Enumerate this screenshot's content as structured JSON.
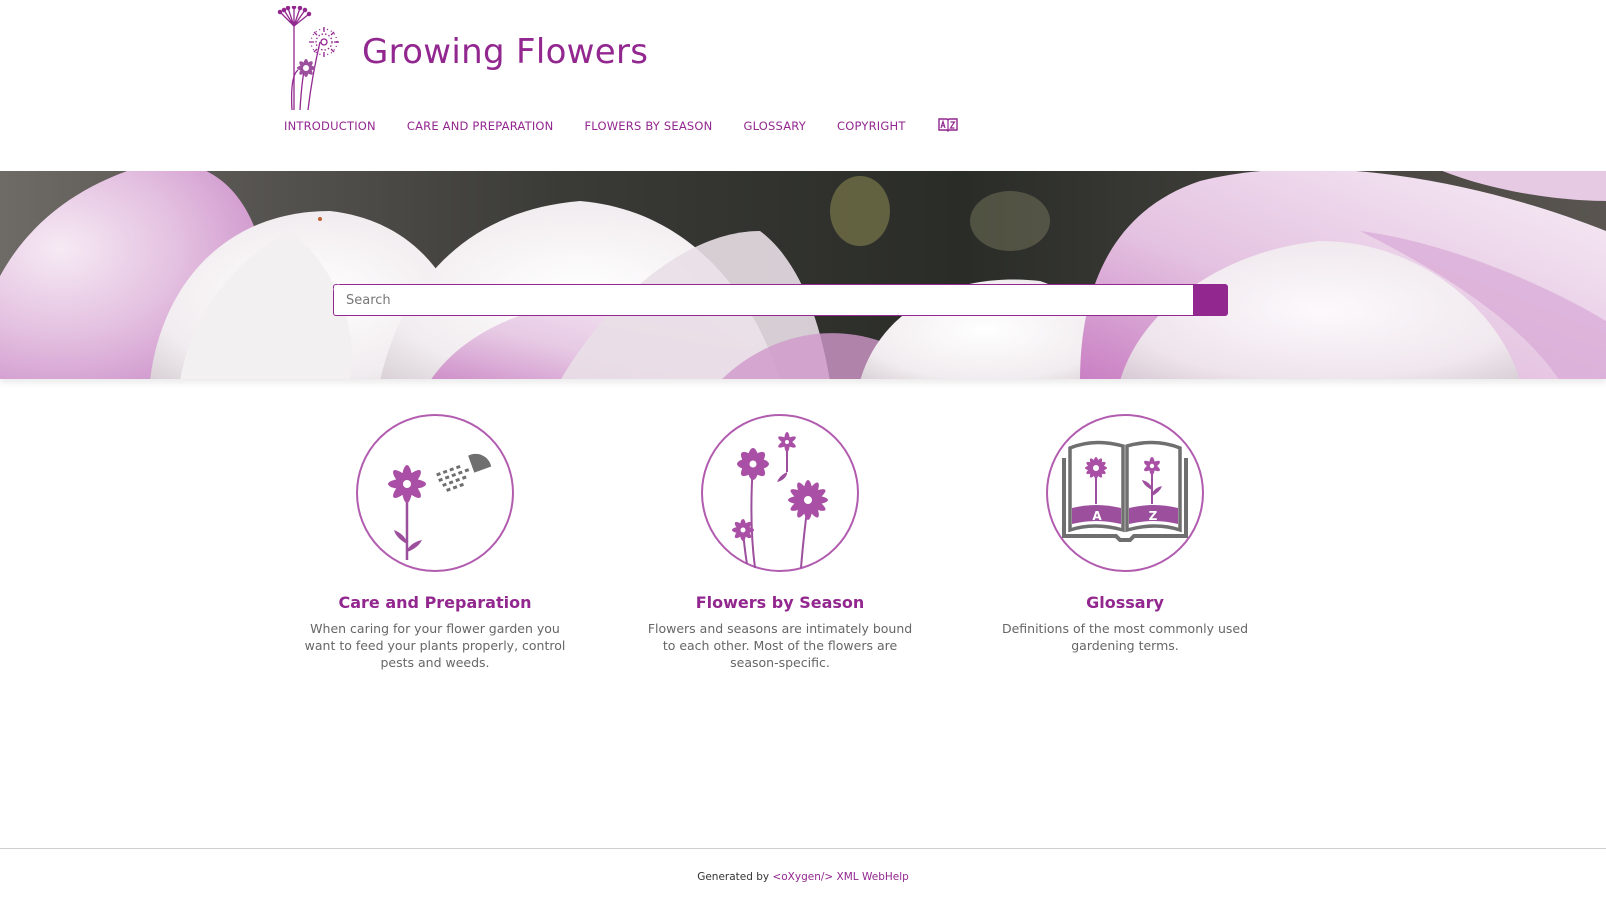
{
  "header": {
    "site_title": "Growing Flowers",
    "nav": [
      {
        "label": "Introduction"
      },
      {
        "label": "Care and Preparation"
      },
      {
        "label": "Flowers by Season"
      },
      {
        "label": "Glossary"
      },
      {
        "label": "Copyright"
      }
    ],
    "index_icon": "book-az-icon"
  },
  "search": {
    "placeholder": "Search",
    "button_icon": "search-icon"
  },
  "tiles": [
    {
      "title": "Care and Preparation",
      "description": "When caring for your flower garden you want to feed your plants properly, control pests and weeds.",
      "icon": "flower-watering-icon"
    },
    {
      "title": "Flowers by Season",
      "description": "Flowers and seasons are intimately bound to each other. Most of the flowers are season-specific.",
      "icon": "flowers-icon"
    },
    {
      "title": "Glossary",
      "description": "Definitions of the most commonly used gardening terms.",
      "icon": "glossary-book-icon"
    }
  ],
  "footer": {
    "generated_by": "Generated by",
    "link_text": "<oXygen/> XML WebHelp"
  },
  "colors": {
    "accent": "#92278f",
    "text_muted": "#666666"
  }
}
